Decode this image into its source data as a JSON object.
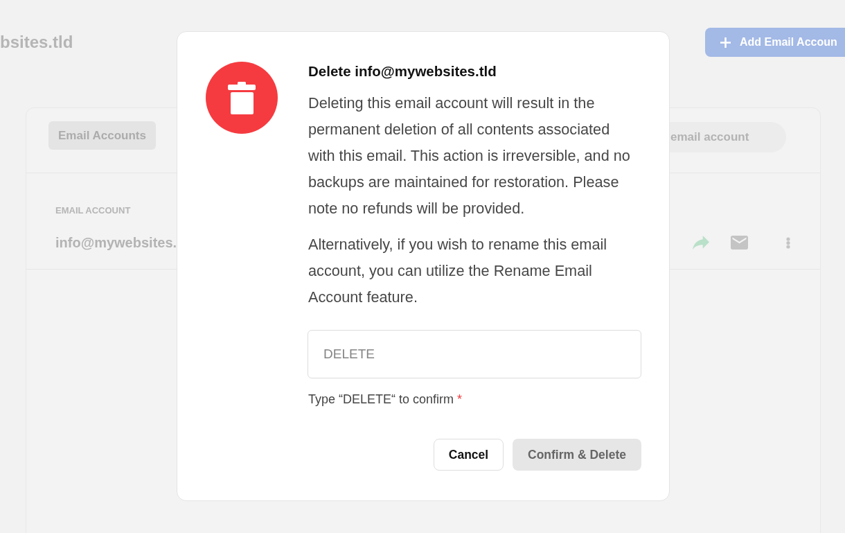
{
  "page": {
    "title": "bsites.tld",
    "add_button": {
      "label": "Add Email Accoun"
    }
  },
  "card": {
    "tabs": [
      {
        "label": "Email Accounts",
        "selected": true
      }
    ],
    "search": {
      "placeholder": "email account"
    },
    "table": {
      "columns": [
        "EMAIL ACCOUNT"
      ],
      "rows": [
        {
          "email": "info@mywebsites."
        }
      ]
    }
  },
  "dialog": {
    "title": "Delete info@mywebsites.tld",
    "paragraphs": [
      "Deleting this email account will result in the permanent deletion of all contents associated with this email. This action is irreversible, and no backups are maintained for restoration. Please note no refunds will be provided.",
      "Alternatively, if you wish to rename this email account, you can utilize the Rename Email Account feature."
    ],
    "confirm_field": {
      "placeholder": "DELETE"
    },
    "hint": "Type “DELETE“ to confirm",
    "required_mark": "*",
    "buttons": [
      {
        "label": "Cancel",
        "kind": "secondary",
        "disabled": false
      },
      {
        "label": "Confirm & Delete",
        "kind": "danger",
        "disabled": true
      }
    ]
  }
}
